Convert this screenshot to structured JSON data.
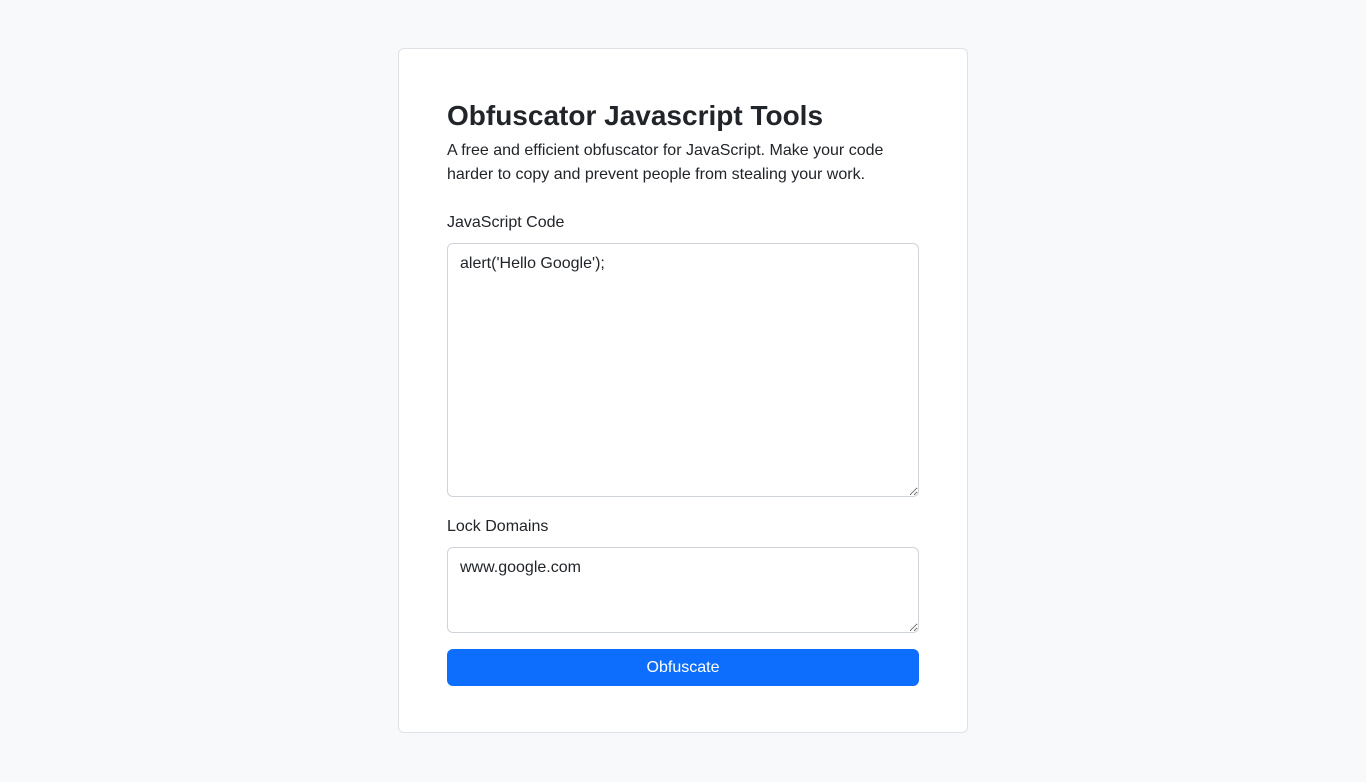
{
  "colors": {
    "page_background": "#f8f9fa",
    "card_background": "#ffffff",
    "text": "#212529",
    "border": "#ced4da",
    "primary_button": "#0d6efd",
    "button_text": "#ffffff"
  },
  "header": {
    "title": "Obfuscator Javascript Tools",
    "description": "A free and efficient obfuscator for JavaScript. Make your code harder to copy and prevent people from stealing your work."
  },
  "form": {
    "code_label": "JavaScript Code",
    "code_value": "alert('Hello Google');",
    "domains_label": "Lock Domains",
    "domains_value": "www.google.com",
    "submit_label": "Obfuscate"
  }
}
